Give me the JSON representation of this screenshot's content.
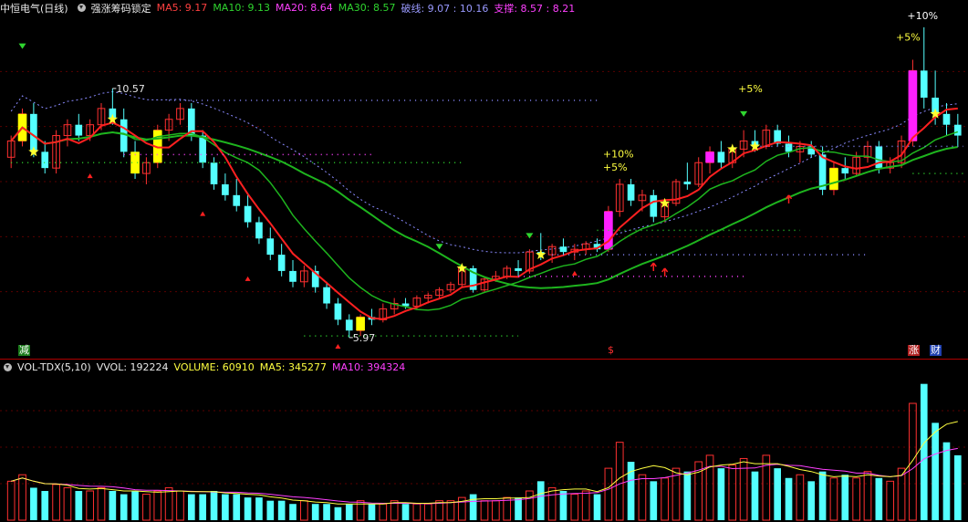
{
  "header": {
    "stock_name": "中恒电气(日线)",
    "indicator_name": "强涨筹码锁定",
    "ma5": "MA5: 9.17",
    "ma10": "MA10: 9.13",
    "ma20": "MA20: 8.64",
    "ma30": "MA30: 8.57",
    "breakline": "破线: 9.07 : 10.16",
    "support": "支撑: 8.57 : 8.21",
    "colors": {
      "ma5": "#ff4040",
      "ma10": "#2fd52f",
      "ma20": "#ff40ff",
      "ma30": "#2fd52f",
      "breakline": "#9a9aff",
      "support": "#ff40ff"
    }
  },
  "volume_header": {
    "title": "VOL-TDX(5,10)",
    "vvol": "VVOL: 192224",
    "volume": "VOLUME: 60910",
    "ma5": "MA5: 345277",
    "ma10": "MA10: 394324"
  },
  "markers": {
    "jian": "减",
    "dollar": "$",
    "zhang": "涨",
    "cai": "财"
  },
  "chart_data": {
    "type": "candlestick",
    "price_annotations": {
      "high_label": "10.57",
      "low_label": "5.97",
      "pct_labels": [
        "+10%",
        "+5%",
        "+5%",
        "+10%",
        "+5%"
      ]
    },
    "ohlc": [
      [
        9.3,
        9.7,
        9.1,
        9.6
      ],
      [
        9.6,
        10.2,
        9.5,
        10.1
      ],
      [
        10.1,
        10.3,
        9.3,
        9.4
      ],
      [
        9.4,
        9.6,
        9.0,
        9.1
      ],
      [
        9.1,
        9.8,
        9.0,
        9.7
      ],
      [
        9.7,
        10.0,
        9.5,
        9.9
      ],
      [
        9.9,
        10.1,
        9.6,
        9.7
      ],
      [
        9.7,
        10.0,
        9.6,
        9.9
      ],
      [
        9.9,
        10.3,
        9.8,
        10.2
      ],
      [
        10.2,
        10.57,
        9.9,
        10.0
      ],
      [
        10.0,
        10.2,
        9.3,
        9.4
      ],
      [
        9.4,
        9.6,
        8.9,
        9.0
      ],
      [
        9.0,
        9.3,
        8.8,
        9.2
      ],
      [
        9.2,
        9.9,
        9.1,
        9.8
      ],
      [
        9.8,
        10.1,
        9.6,
        10.0
      ],
      [
        10.0,
        10.3,
        9.9,
        10.2
      ],
      [
        10.2,
        10.3,
        9.6,
        9.7
      ],
      [
        9.7,
        9.8,
        9.1,
        9.2
      ],
      [
        9.2,
        9.3,
        8.7,
        8.8
      ],
      [
        8.8,
        9.0,
        8.5,
        8.6
      ],
      [
        8.6,
        8.9,
        8.3,
        8.4
      ],
      [
        8.4,
        8.6,
        8.0,
        8.1
      ],
      [
        8.1,
        8.2,
        7.7,
        7.8
      ],
      [
        7.8,
        8.0,
        7.4,
        7.5
      ],
      [
        7.5,
        7.7,
        7.1,
        7.2
      ],
      [
        7.2,
        7.4,
        6.9,
        7.0
      ],
      [
        7.0,
        7.3,
        6.9,
        7.2
      ],
      [
        7.2,
        7.3,
        6.8,
        6.9
      ],
      [
        6.9,
        7.0,
        6.5,
        6.6
      ],
      [
        6.6,
        6.7,
        6.2,
        6.3
      ],
      [
        6.3,
        6.4,
        5.97,
        6.1
      ],
      [
        6.1,
        6.4,
        6.0,
        6.35
      ],
      [
        6.35,
        6.5,
        6.2,
        6.3
      ],
      [
        6.3,
        6.6,
        6.25,
        6.5
      ],
      [
        6.5,
        6.7,
        6.4,
        6.6
      ],
      [
        6.6,
        6.7,
        6.5,
        6.55
      ],
      [
        6.55,
        6.75,
        6.5,
        6.7
      ],
      [
        6.7,
        6.8,
        6.6,
        6.75
      ],
      [
        6.75,
        6.9,
        6.7,
        6.85
      ],
      [
        6.85,
        7.0,
        6.8,
        6.95
      ],
      [
        6.95,
        7.3,
        6.9,
        7.25
      ],
      [
        7.25,
        7.3,
        6.8,
        6.85
      ],
      [
        6.85,
        7.1,
        6.8,
        7.05
      ],
      [
        7.05,
        7.2,
        7.0,
        7.1
      ],
      [
        7.1,
        7.3,
        7.05,
        7.25
      ],
      [
        7.25,
        7.4,
        7.1,
        7.2
      ],
      [
        7.2,
        7.6,
        7.15,
        7.55
      ],
      [
        7.55,
        7.9,
        7.4,
        7.5
      ],
      [
        7.5,
        7.7,
        7.35,
        7.65
      ],
      [
        7.65,
        7.8,
        7.5,
        7.55
      ],
      [
        7.55,
        7.7,
        7.4,
        7.6
      ],
      [
        7.6,
        7.75,
        7.5,
        7.7
      ],
      [
        7.7,
        7.8,
        7.55,
        7.6
      ],
      [
        7.6,
        8.4,
        7.55,
        8.3
      ],
      [
        8.3,
        8.9,
        8.2,
        8.8
      ],
      [
        8.8,
        8.9,
        8.4,
        8.5
      ],
      [
        8.5,
        8.7,
        8.3,
        8.6
      ],
      [
        8.6,
        8.7,
        8.1,
        8.2
      ],
      [
        8.2,
        8.5,
        8.1,
        8.45
      ],
      [
        8.45,
        8.9,
        8.4,
        8.85
      ],
      [
        8.85,
        9.2,
        8.7,
        8.8
      ],
      [
        8.8,
        9.3,
        8.75,
        9.2
      ],
      [
        9.2,
        9.5,
        9.0,
        9.4
      ],
      [
        9.4,
        9.6,
        9.1,
        9.2
      ],
      [
        9.2,
        9.5,
        9.1,
        9.45
      ],
      [
        9.45,
        9.8,
        9.3,
        9.6
      ],
      [
        9.6,
        9.8,
        9.4,
        9.5
      ],
      [
        9.5,
        9.9,
        9.45,
        9.8
      ],
      [
        9.8,
        9.9,
        9.5,
        9.55
      ],
      [
        9.55,
        9.7,
        9.3,
        9.4
      ],
      [
        9.4,
        9.6,
        9.2,
        9.5
      ],
      [
        9.5,
        9.6,
        9.3,
        9.35
      ],
      [
        9.35,
        9.5,
        8.6,
        8.7
      ],
      [
        8.7,
        9.2,
        8.6,
        9.1
      ],
      [
        9.1,
        9.3,
        8.9,
        9.0
      ],
      [
        9.0,
        9.4,
        8.95,
        9.3
      ],
      [
        9.3,
        9.6,
        9.2,
        9.5
      ],
      [
        9.5,
        9.6,
        9.0,
        9.1
      ],
      [
        9.1,
        9.3,
        9.0,
        9.2
      ],
      [
        9.2,
        9.7,
        9.1,
        9.6
      ],
      [
        9.6,
        11.1,
        9.5,
        10.9
      ],
      [
        10.9,
        11.7,
        10.2,
        10.4
      ],
      [
        10.4,
        10.9,
        9.9,
        10.1
      ],
      [
        10.1,
        10.3,
        9.7,
        9.9
      ],
      [
        9.9,
        10.1,
        9.5,
        9.7
      ]
    ],
    "volume": [
      12,
      14,
      10,
      9,
      11,
      10,
      9,
      9,
      10,
      9,
      8,
      9,
      8,
      9,
      10,
      9,
      8,
      8,
      9,
      8,
      8,
      7,
      7,
      6,
      6,
      5,
      6,
      5,
      5,
      4,
      5,
      6,
      5,
      5,
      6,
      5,
      5,
      5,
      6,
      6,
      7,
      8,
      6,
      6,
      7,
      7,
      9,
      12,
      10,
      9,
      8,
      9,
      8,
      16,
      24,
      18,
      14,
      12,
      13,
      16,
      15,
      18,
      20,
      16,
      17,
      19,
      15,
      20,
      16,
      13,
      14,
      12,
      15,
      13,
      14,
      13,
      15,
      13,
      12,
      16,
      36,
      42,
      30,
      24,
      20
    ],
    "yrange": [
      5.8,
      11.9
    ],
    "vol_max": 45
  }
}
